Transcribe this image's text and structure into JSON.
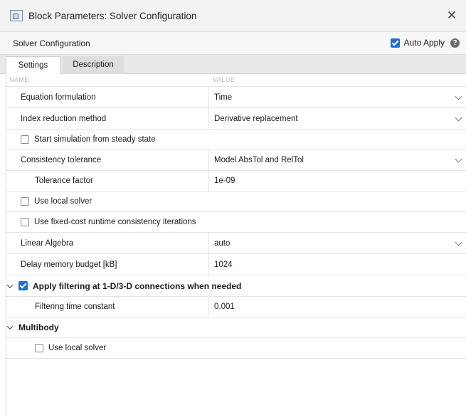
{
  "window": {
    "title": "Block Parameters: Solver Configuration",
    "close_glyph": "✕"
  },
  "header": {
    "block_name": "Solver Configuration",
    "auto_apply_label": "Auto Apply",
    "auto_apply_checked": true,
    "help_glyph": "?"
  },
  "tabs": [
    {
      "label": "Settings",
      "active": true
    },
    {
      "label": "Description",
      "active": false
    }
  ],
  "columns": {
    "name": "NAME",
    "value": "VALUE"
  },
  "params": {
    "equation_formulation": {
      "label": "Equation formulation",
      "value": "Time"
    },
    "index_reduction": {
      "label": "Index reduction method",
      "value": "Derivative replacement"
    },
    "start_steady_state": {
      "label": "Start simulation from steady state",
      "checked": false
    },
    "consistency_tolerance": {
      "label": "Consistency tolerance",
      "value": "Model AbsTol and RelTol"
    },
    "tolerance_factor": {
      "label": "Tolerance factor",
      "value": "1e-09"
    },
    "use_local_solver": {
      "label": "Use local solver",
      "checked": false
    },
    "fixed_cost": {
      "label": "Use fixed-cost runtime consistency iterations",
      "checked": false
    },
    "linear_algebra": {
      "label": "Linear Algebra",
      "value": "auto"
    },
    "delay_memory": {
      "label": "Delay memory budget [kB]",
      "value": "1024"
    },
    "filtering": {
      "label": "Apply filtering at 1-D/3-D connections when needed",
      "checked": true
    },
    "filtering_time_constant": {
      "label": "Filtering time constant",
      "value": "0.001"
    },
    "multibody": {
      "label": "Multibody"
    },
    "multibody_local_solver": {
      "label": "Use local solver",
      "checked": false
    }
  },
  "colors": {
    "accent": "#1f6fcf"
  }
}
